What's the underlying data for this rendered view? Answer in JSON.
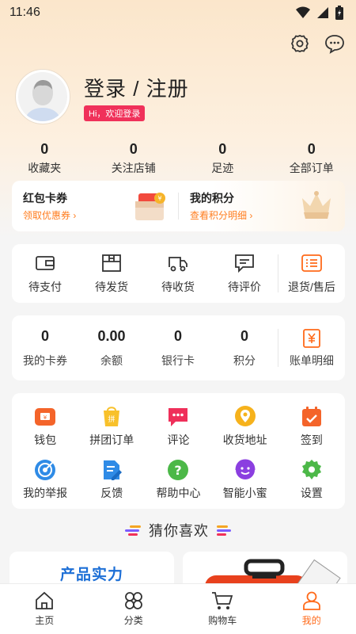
{
  "status_bar": {
    "time": "11:46"
  },
  "profile": {
    "title": "登录 / 注册",
    "badge": "Hi，欢迎登录"
  },
  "stats": [
    {
      "value": "0",
      "label": "收藏夹"
    },
    {
      "value": "0",
      "label": "关注店铺"
    },
    {
      "value": "0",
      "label": "足迹"
    },
    {
      "value": "0",
      "label": "全部订单"
    }
  ],
  "promo": {
    "left": {
      "title": "红包卡券",
      "link": "领取优惠券"
    },
    "right": {
      "title": "我的积分",
      "link": "查看积分明细"
    }
  },
  "orders": {
    "items": [
      "待支付",
      "待发货",
      "待收货",
      "待评价"
    ],
    "returns": "退货/售后"
  },
  "wallet": {
    "items": [
      {
        "value": "0",
        "label": "我的卡券"
      },
      {
        "value": "0.00",
        "label": "余额"
      },
      {
        "value": "0",
        "label": "银行卡"
      },
      {
        "value": "0",
        "label": "积分"
      }
    ],
    "bill": "账单明细"
  },
  "services": {
    "row1": [
      "钱包",
      "拼团订单",
      "评论",
      "收货地址",
      "签到"
    ],
    "row2": [
      "我的举报",
      "反馈",
      "帮助中心",
      "智能小蜜",
      "设置"
    ]
  },
  "guess": {
    "title": "猜你喜欢"
  },
  "product_left": {
    "title": "产品实力"
  },
  "tabs": [
    {
      "label": "主页",
      "active": false
    },
    {
      "label": "分类",
      "active": false
    },
    {
      "label": "购物车",
      "active": false
    },
    {
      "label": "我的",
      "active": true
    }
  ],
  "colors": {
    "accent": "#ff6a1a",
    "badge": "#f0315a",
    "link": "#ff7d1f",
    "product_title": "#1d6fd6"
  }
}
